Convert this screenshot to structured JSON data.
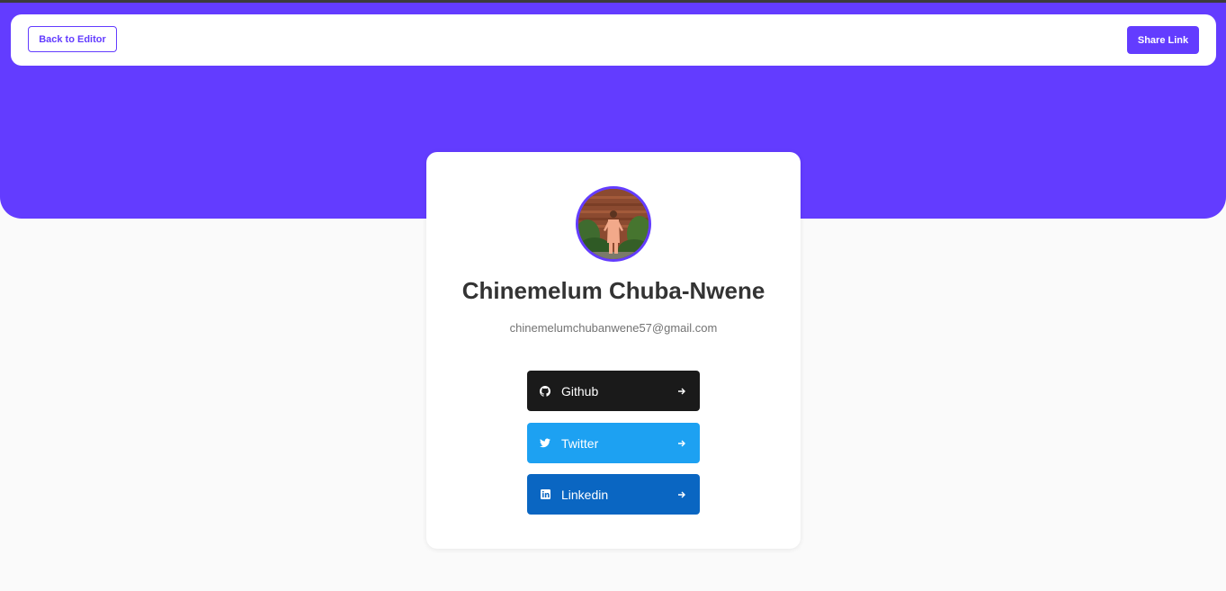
{
  "nav": {
    "back_label": "Back to Editor",
    "share_label": "Share Link"
  },
  "profile": {
    "name": "Chinemelum Chuba-Nwene",
    "email": "chinemelumchubanwene57@gmail.com"
  },
  "links": [
    {
      "label": "Github",
      "icon": "github-icon",
      "color": "#1a1a1a"
    },
    {
      "label": "Twitter",
      "icon": "twitter-icon",
      "color": "#1da1f2"
    },
    {
      "label": "Linkedin",
      "icon": "linkedin-icon",
      "color": "#0a66c2"
    }
  ],
  "colors": {
    "accent": "#633cff",
    "background": "#fafafa"
  }
}
